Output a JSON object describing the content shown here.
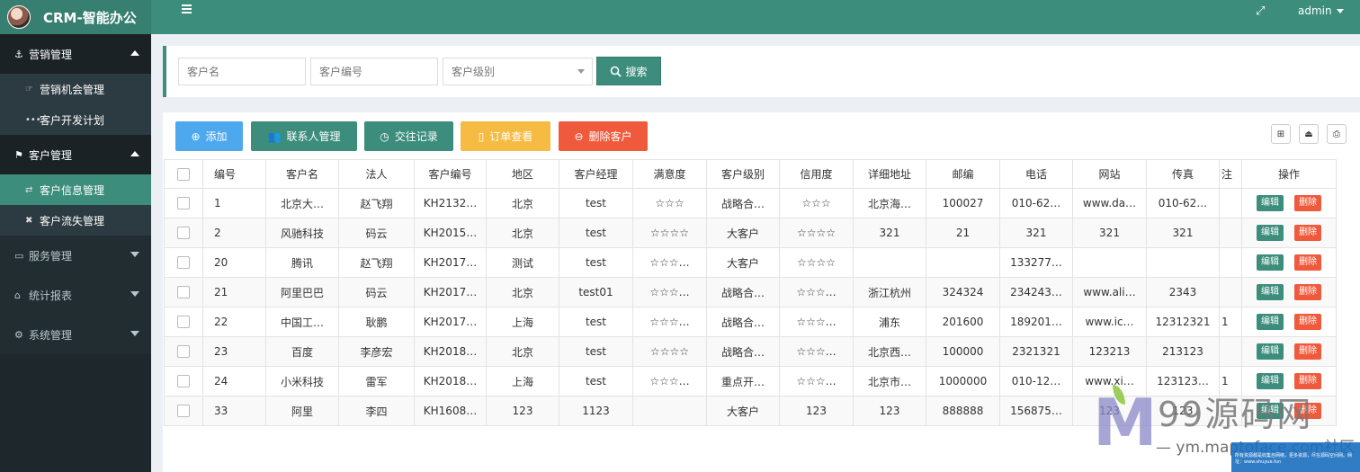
{
  "app": {
    "title": "CRM-智能办公"
  },
  "topbar": {
    "user": "admin"
  },
  "sidebar": {
    "groups": [
      {
        "label": "营销管理",
        "items": [
          "营销机会管理",
          "客户开发计划"
        ]
      },
      {
        "label": "客户管理",
        "items": [
          "客户信息管理",
          "客户流失管理"
        ]
      },
      {
        "label": "服务管理"
      },
      {
        "label": "统计报表"
      },
      {
        "label": "系统管理"
      }
    ]
  },
  "search": {
    "name_placeholder": "客户名",
    "code_placeholder": "客户编号",
    "level_placeholder": "客户级别",
    "button": "搜索"
  },
  "toolbar": {
    "add": "添加",
    "contacts": "联系人管理",
    "records": "交往记录",
    "orders": "订单查看",
    "delete": "删除客户"
  },
  "table": {
    "headers": [
      "编号",
      "客户名",
      "法人",
      "客户编号",
      "地区",
      "客户经理",
      "满意度",
      "客户级别",
      "信用度",
      "详细地址",
      "邮编",
      "电话",
      "网站",
      "传真",
      "注",
      "操作"
    ],
    "edit_label": "编辑",
    "delete_label": "删除",
    "rows": [
      [
        "1",
        "北京大…",
        "赵飞翔",
        "KH2132…",
        "北京",
        "test",
        "☆☆☆",
        "战略合…",
        "☆☆☆",
        "北京海…",
        "100027",
        "010-62…",
        "www.da…",
        "010-62…",
        ""
      ],
      [
        "2",
        "风驰科技",
        "码云",
        "KH2015…",
        "北京",
        "test",
        "☆☆☆☆",
        "大客户",
        "☆☆☆☆",
        "321",
        "21",
        "321",
        "321",
        "321",
        ""
      ],
      [
        "20",
        "腾讯",
        "赵飞翔",
        "KH2017…",
        "测试",
        "test",
        "☆☆☆…",
        "大客户",
        "☆☆☆☆",
        "",
        "",
        "133277…",
        "",
        "",
        ""
      ],
      [
        "21",
        "阿里巴巴",
        "码云",
        "KH2017…",
        "北京",
        "test01",
        "☆☆☆…",
        "战略合…",
        "☆☆☆…",
        "浙江杭州",
        "324324",
        "234243…",
        "www.ali…",
        "2343",
        ""
      ],
      [
        "22",
        "中国工…",
        "耿鹏",
        "KH2017…",
        "上海",
        "test",
        "☆☆☆…",
        "战略合…",
        "☆☆☆…",
        "浦东",
        "201600",
        "189201…",
        "www.ic…",
        "12312321",
        "1"
      ],
      [
        "23",
        "百度",
        "李彦宏",
        "KH2018…",
        "北京",
        "test",
        "☆☆☆☆",
        "战略合…",
        "☆☆☆…",
        "北京西…",
        "100000",
        "2321321",
        "123213",
        "213123",
        ""
      ],
      [
        "24",
        "小米科技",
        "雷军",
        "KH2018…",
        "上海",
        "test",
        "☆☆☆…",
        "重点开…",
        "☆☆☆…",
        "北京市…",
        "1000000",
        "010-12…",
        "www.xi…",
        "123123…",
        "1"
      ],
      [
        "33",
        "阿里",
        "李四",
        "KH1608…",
        "123",
        "1123",
        "",
        "大客户",
        "123",
        "123",
        "888888",
        "156875…",
        "123",
        "123",
        ""
      ]
    ]
  },
  "watermark": {
    "brand": "99源码网",
    "url": "— ym.maptoface.com社区",
    "note": "所有资源都是收集自网络，更多资源，尽在源码空间网。网址：www.shuyue.fun"
  }
}
